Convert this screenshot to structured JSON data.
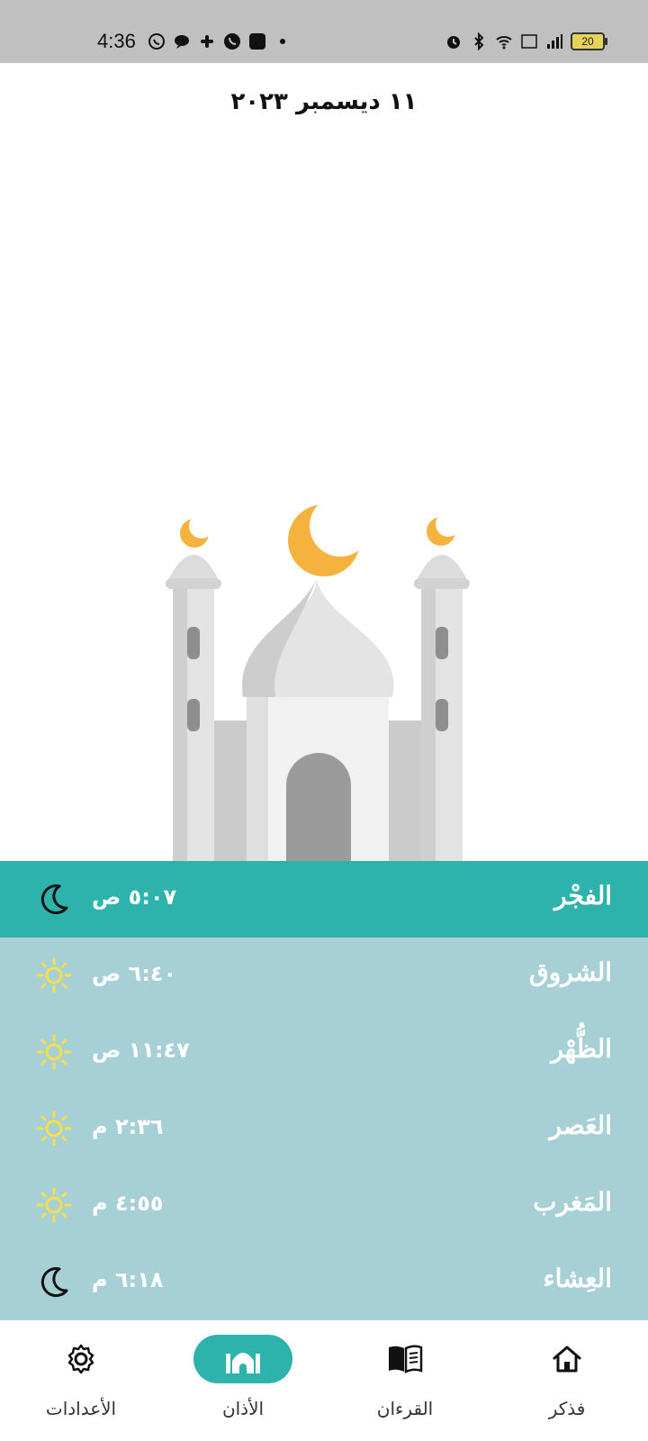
{
  "status_bar": {
    "time": "4:36",
    "battery": "20"
  },
  "header": {
    "date": "١١ ديسمبر ٢٠٢٣"
  },
  "prayers": [
    {
      "name": "الفجْر",
      "time": "٥:٠٧ ص",
      "icon": "moon-icon",
      "active": true
    },
    {
      "name": "الشروق",
      "time": "٦:٤٠ ص",
      "icon": "sun-icon",
      "active": false
    },
    {
      "name": "الظُّهْر",
      "time": "١١:٤٧ ص",
      "icon": "sun-icon",
      "active": false
    },
    {
      "name": "العَصر",
      "time": "٢:٣٦ م",
      "icon": "sun-icon",
      "active": false
    },
    {
      "name": "المَغرب",
      "time": "٤:٥٥ م",
      "icon": "sun-icon",
      "active": false
    },
    {
      "name": "العِشاء",
      "time": "٦:١٨ م",
      "icon": "moon-icon",
      "active": false
    }
  ],
  "nav": [
    {
      "label": "الأعدادات",
      "icon": "gear-icon",
      "active": false
    },
    {
      "label": "الأذان",
      "icon": "mosque-icon",
      "active": true
    },
    {
      "label": "القرءان",
      "icon": "book-icon",
      "active": false
    },
    {
      "label": "فذكر",
      "icon": "home-icon",
      "active": false
    }
  ],
  "colors": {
    "accent": "#2db2ac",
    "prayer_bg": "#a6d0d6",
    "crescent": "#f5b23e",
    "sun": "#f7e04a"
  }
}
